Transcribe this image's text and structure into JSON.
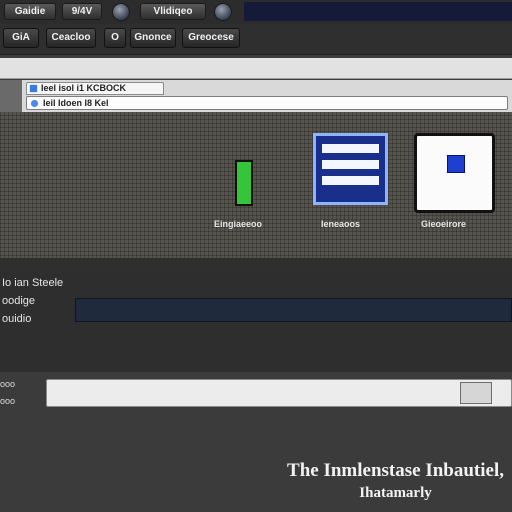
{
  "topbar": {
    "btn1_label": "Gaidie",
    "btn2_label": "9/4V",
    "btn3_label": "Vlidiqeo",
    "icons": [
      "shield-icon",
      "settings-icon"
    ]
  },
  "toolbar": {
    "items": [
      "GiA",
      "Ceacloo",
      "O",
      "Gnonce",
      "Greocese"
    ]
  },
  "browser": {
    "tab_label": "Ieel isol i1 KCBOCK",
    "address_value": "Ieil Idoen I8 Kel"
  },
  "canvas": {
    "progress": 0.85,
    "captions": [
      "Eingiaeeoo",
      "Ieneaoos",
      "Gieoeirore"
    ]
  },
  "settings": {
    "label1": "Io ian Steele",
    "label2": "oodige",
    "label3": "ouidio"
  },
  "lower": {
    "side1": "ooo",
    "side2": "ooo"
  },
  "footer": {
    "line1": "The Inmlenstase Inbautiel,",
    "line2": "Ihatamarly"
  },
  "colors": {
    "accent_green": "#35c43a",
    "accent_blue": "#1a2f8c",
    "navy": "#141a38"
  }
}
